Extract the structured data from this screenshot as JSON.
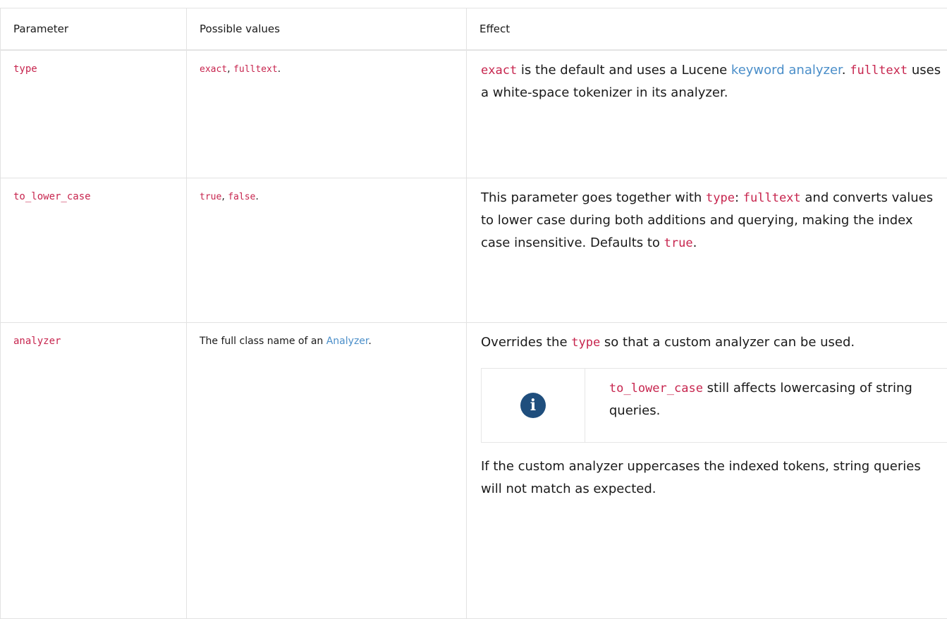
{
  "table": {
    "headers": [
      "Parameter",
      "Possible values",
      "Effect"
    ],
    "rows": [
      {
        "name": "type",
        "values": {
          "v1": "exact",
          "sep": ", ",
          "v2": "fulltext",
          "end": "."
        },
        "effect": {
          "c1": "exact",
          "t1": " is the default and uses a Lucene ",
          "link": "keyword analyzer",
          "t2": ". ",
          "c2": "fulltext",
          "t3": " uses a white-space tokenizer in its analyzer."
        }
      },
      {
        "name": "to_lower_case",
        "values": {
          "v1": "true",
          "sep": ", ",
          "v2": "false",
          "end": "."
        },
        "effect": {
          "t1": "This parameter goes together with ",
          "c1": "type",
          "t2": ": ",
          "c2": "fulltext",
          "t3": " and converts values to lower case during both additions and querying, making the index case insensitive. Defaults to ",
          "c3": "true",
          "t4": "."
        }
      },
      {
        "name": "analyzer",
        "values": {
          "text": "The full class name of an ",
          "link": "Analyzer",
          "end": "."
        },
        "effect": {
          "t1": "Overrides the ",
          "c1": "type",
          "t2": " so that a custom analyzer can be used.",
          "note": {
            "icon": "info-icon",
            "code": "to_lower_case",
            "text": " still affects lowercasing of string queries."
          },
          "t3": "If the custom analyzer uppercases the indexed tokens, string queries will not match as expected."
        }
      }
    ]
  },
  "colors": {
    "code": "#c7254e",
    "link": "#4a8ec9",
    "icon_bg": "#1f4e7d",
    "border": "#e2e2e2"
  }
}
